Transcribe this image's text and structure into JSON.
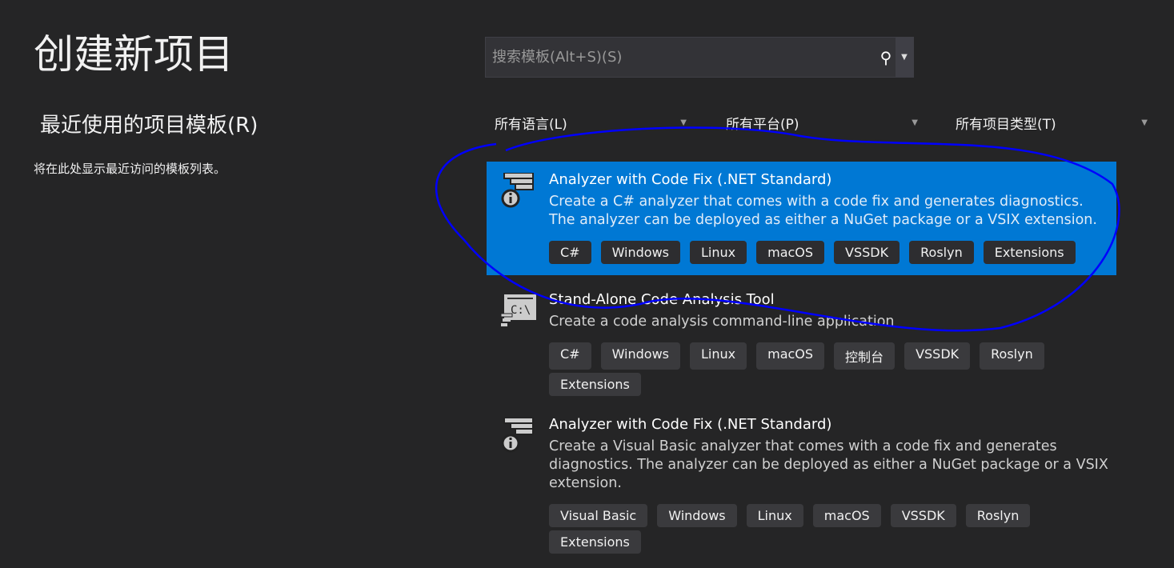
{
  "header": {
    "title": "创建新项目"
  },
  "recent": {
    "heading": "最近使用的项目模板(R)",
    "empty_text": "将在此处显示最近访问的模板列表。"
  },
  "search": {
    "placeholder": "搜索模板(Alt+S)(S)",
    "value": ""
  },
  "filters": [
    {
      "label": "所有语言(L)"
    },
    {
      "label": "所有平台(P)"
    },
    {
      "label": "所有项目类型(T)"
    }
  ],
  "colors": {
    "selected": "#0078d4",
    "background": "#252526",
    "annotation": "#0000ff"
  },
  "templates": [
    {
      "name": "Analyzer with Code Fix (.NET Standard)",
      "description": "Create a C# analyzer that comes with a code fix and generates diagnostics. The analyzer can be deployed as either a NuGet package or a VSIX extension.",
      "tags": [
        "C#",
        "Windows",
        "Linux",
        "macOS",
        "VSSDK",
        "Roslyn",
        "Extensions"
      ],
      "icon": "analyzer-icon",
      "selected": true
    },
    {
      "name": "Stand-Alone Code Analysis Tool",
      "description": "Create a code analysis command-line application",
      "tags": [
        "C#",
        "Windows",
        "Linux",
        "macOS",
        "控制台",
        "VSSDK",
        "Roslyn",
        "Extensions"
      ],
      "icon": "console-icon",
      "selected": false
    },
    {
      "name": "Analyzer with Code Fix (.NET Standard)",
      "description": "Create a Visual Basic analyzer that comes with a code fix and generates diagnostics. The analyzer can be deployed as either a NuGet package or a VSIX extension.",
      "tags": [
        "Visual Basic",
        "Windows",
        "Linux",
        "macOS",
        "VSSDK",
        "Roslyn",
        "Extensions"
      ],
      "icon": "analyzer-icon",
      "selected": false
    }
  ]
}
